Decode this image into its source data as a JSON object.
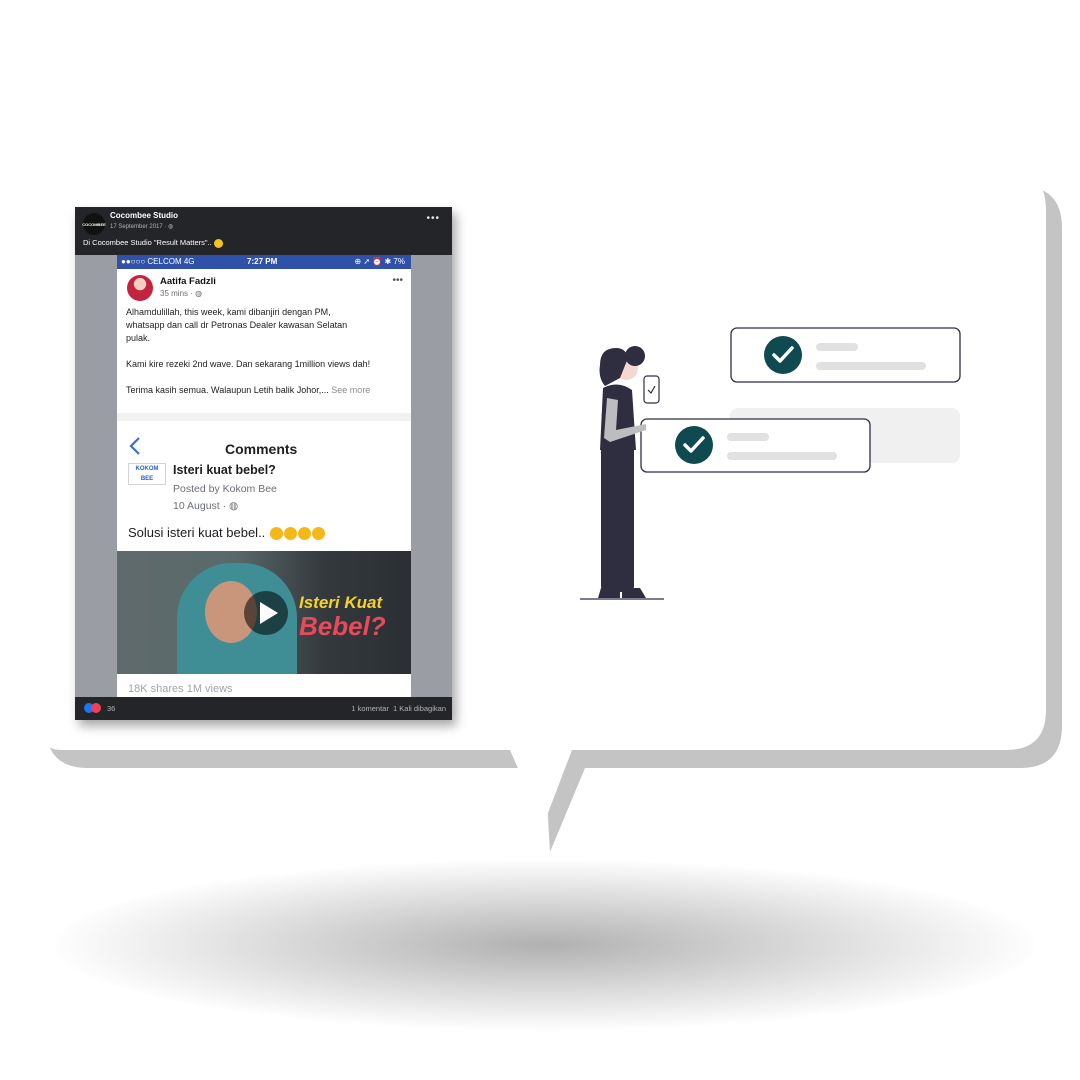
{
  "colors": {
    "bubble_fill": "#ffffff",
    "bubble_shadow": "#c4c4c4",
    "check_teal": "#0f4a50",
    "outline_navy": "#2e2e4a"
  },
  "post": {
    "page_name": "Cocombee Studio",
    "page_logo_text": "COCOMBEE",
    "meta": "17 September 2017 · ",
    "text": "Di Cocombee Studio \"Result Matters\"..",
    "reaction_count": "36",
    "comments_text": "1 komentar",
    "shares_text": "1 Kali dibagikan"
  },
  "phone": {
    "status_left": "●●○○○ CELCOM  4G",
    "time": "7:27 PM",
    "status_right": "⊕ ➚ ⏰ ✱ 7%",
    "author": "Aatifa Fadzli",
    "author_time": "35 mins · ",
    "lines": [
      "Alhamdulillah, this week, kami dibanjiri dengan PM,",
      "whatsapp dan call dr Petronas Dealer kawasan Selatan",
      "pulak.",
      "Kami kire rezeki 2nd wave. Dan sekarang 1million views dah!",
      "Terima kasih semua. Walaupun Letih balik Johor,..."
    ],
    "see_more": "See more",
    "comments_title": "Comments",
    "share_logo": "KOKOM BEE",
    "share_title": "Isteri kuat bebel?",
    "share_by": "Posted by Kokom Bee",
    "share_date": "10 August · ",
    "share_caption": "Solusi isteri kuat bebel..",
    "video_title_1": "Isteri Kuat",
    "video_title_2": "Bebel?",
    "stats": "18K shares   1M views"
  },
  "illustration": {
    "items_checked": 2
  }
}
